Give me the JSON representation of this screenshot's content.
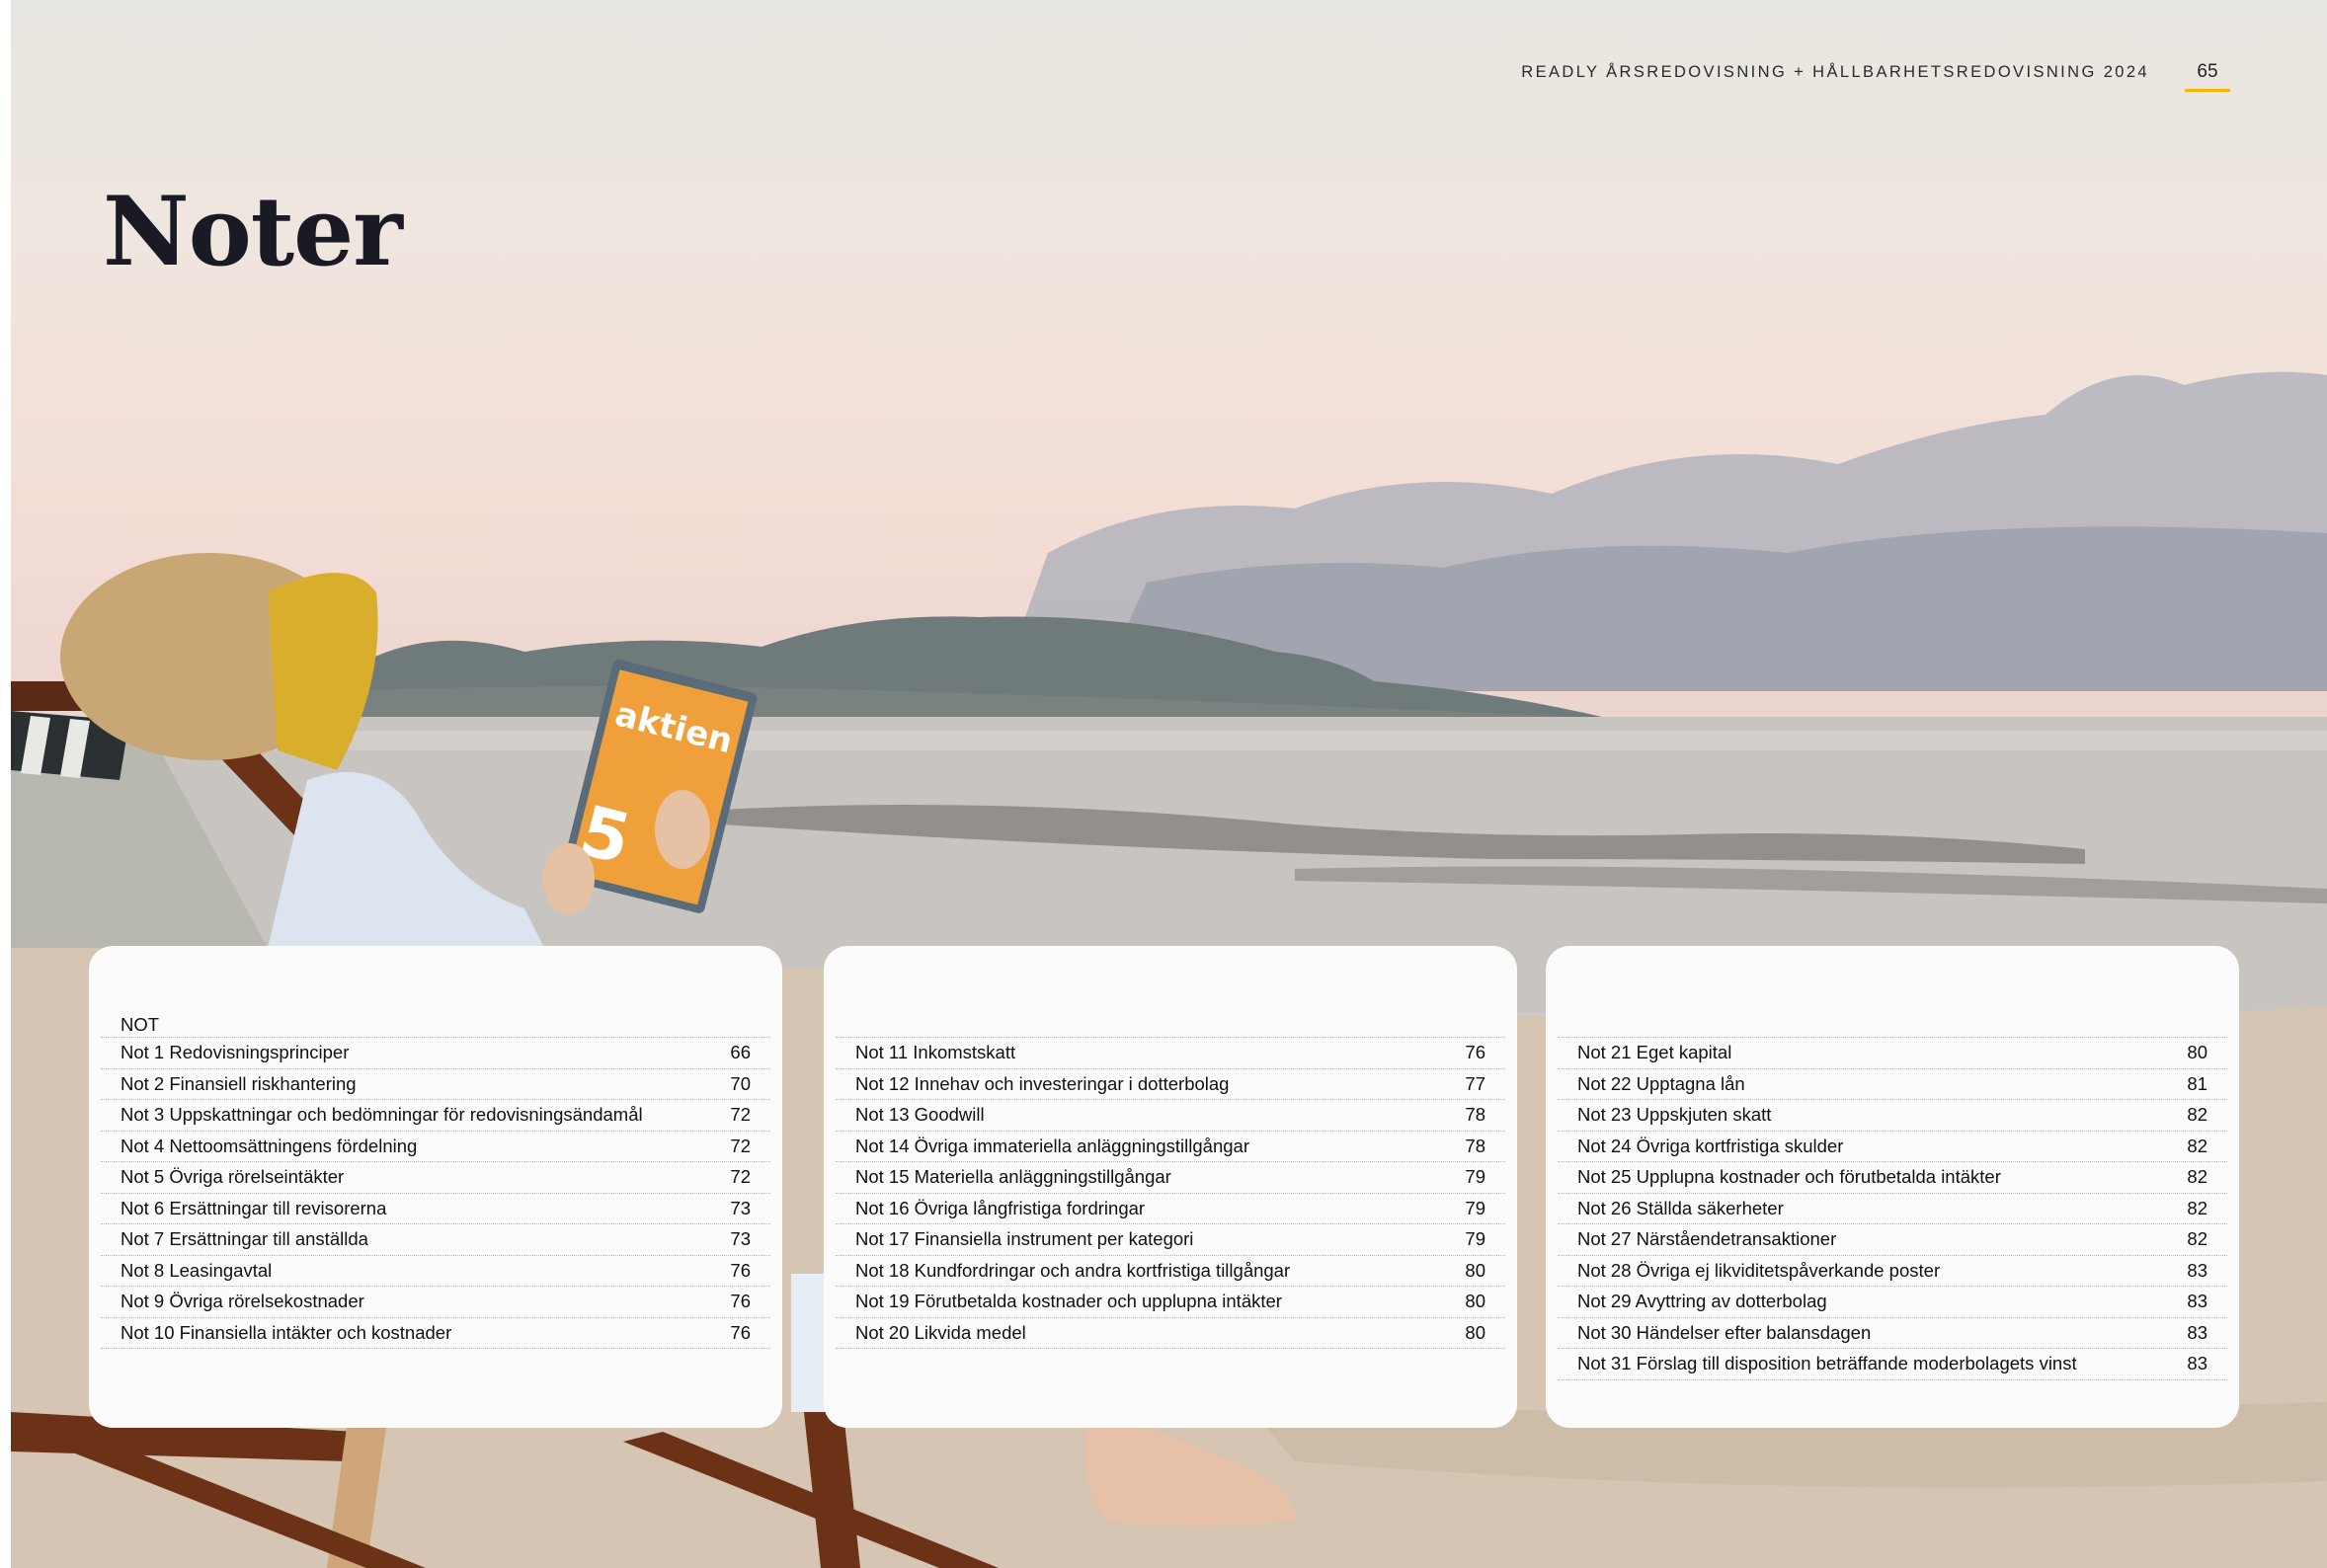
{
  "header": {
    "report_title": "READLY ÅRSREDOVISNING + HÅLLBARHETSREDOVISNING 2024",
    "page_number": "65"
  },
  "title": "Noter",
  "columns": [
    {
      "heading": "NOT",
      "items": [
        {
          "label": "Not 1 Redovisningsprinciper",
          "page": "66"
        },
        {
          "label": "Not 2 Finansiell riskhantering",
          "page": "70"
        },
        {
          "label": "Not 3 Uppskattningar och bedömningar för redovisningsändamål",
          "page": "72"
        },
        {
          "label": "Not 4 Nettoomsättningens fördelning",
          "page": "72"
        },
        {
          "label": "Not 5 Övriga rörelseintäkter",
          "page": "72"
        },
        {
          "label": "Not 6 Ersättningar till revisorerna",
          "page": "73"
        },
        {
          "label": "Not 7 Ersättningar till anställda",
          "page": "73"
        },
        {
          "label": "Not 8 Leasingavtal",
          "page": "76"
        },
        {
          "label": "Not 9 Övriga rörelsekostnader",
          "page": "76"
        },
        {
          "label": "Not 10 Finansiella intäkter och kostnader",
          "page": "76"
        }
      ]
    },
    {
      "heading": "",
      "items": [
        {
          "label": "Not 11 Inkomstskatt",
          "page": "76"
        },
        {
          "label": "Not 12 Innehav och investeringar i dotterbolag",
          "page": "77"
        },
        {
          "label": "Not 13 Goodwill",
          "page": "78"
        },
        {
          "label": "Not 14 Övriga immateriella anläggningstillgångar",
          "page": "78"
        },
        {
          "label": "Not 15 Materiella anläggningstillgångar",
          "page": "79"
        },
        {
          "label": "Not 16 Övriga långfristiga fordringar",
          "page": "79"
        },
        {
          "label": "Not 17 Finansiella instrument per kategori",
          "page": "79"
        },
        {
          "label": "Not 18 Kundfordringar och andra kortfristiga tillgångar",
          "page": "80"
        },
        {
          "label": "Not 19 Förutbetalda kostnader och upplupna intäkter",
          "page": "80"
        },
        {
          "label": "Not 20 Likvida medel",
          "page": "80"
        }
      ]
    },
    {
      "heading": "",
      "items": [
        {
          "label": "Not 21 Eget kapital",
          "page": "80"
        },
        {
          "label": "Not 22 Upptagna lån",
          "page": "81"
        },
        {
          "label": "Not 23 Uppskjuten skatt",
          "page": "82"
        },
        {
          "label": "Not 24 Övriga kortfristiga skulder",
          "page": "82"
        },
        {
          "label": "Not 25 Upplupna kostnader och förutbetalda intäkter",
          "page": "82"
        },
        {
          "label": "Not 26 Ställda säkerheter",
          "page": "82"
        },
        {
          "label": "Not 27 Närståendetransaktioner",
          "page": "82"
        },
        {
          "label": "Not 28 Övriga ej likviditetspåverkande poster",
          "page": "83"
        },
        {
          "label": "Not 29 Avyttring av dotterbolag",
          "page": "83"
        },
        {
          "label": "Not 30 Händelser efter balansdagen",
          "page": "83"
        },
        {
          "label": "Not 31 Förslag till disposition beträffande moderbolagets vinst",
          "page": "83"
        }
      ]
    }
  ],
  "colors": {
    "accent": "#f2b705",
    "panel": "#fbfbfb",
    "title": "#1a1a24"
  },
  "magazine_cover": {
    "word": "aktien",
    "number": "5"
  }
}
